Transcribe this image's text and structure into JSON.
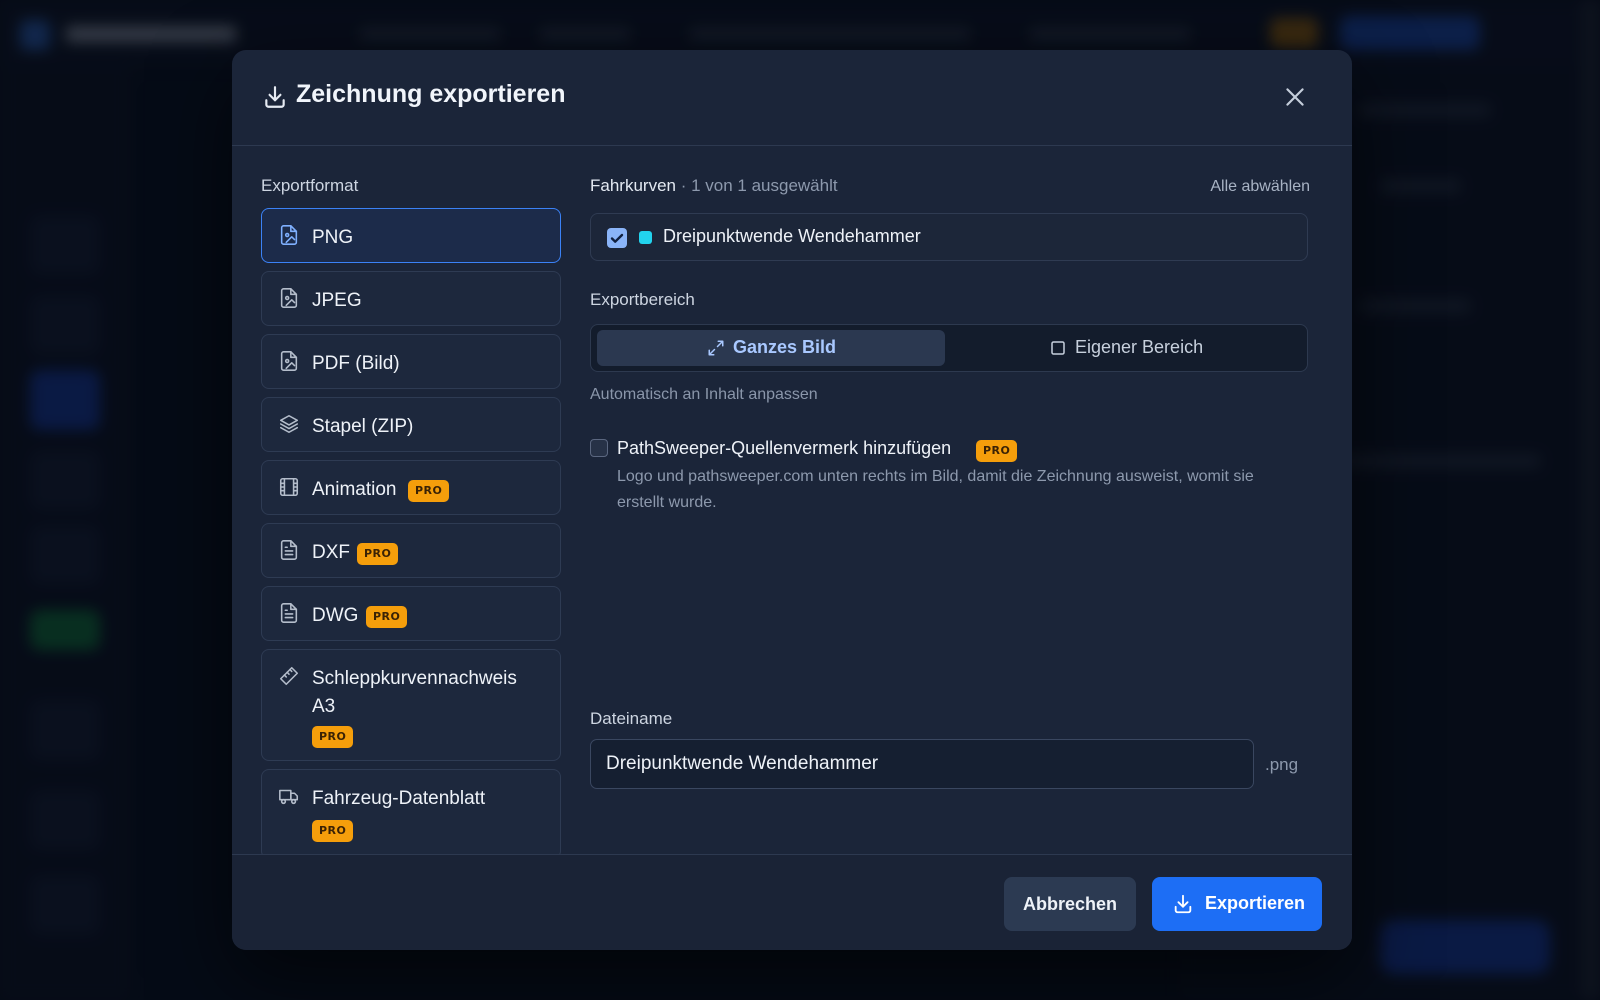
{
  "modal": {
    "title": "Zeichnung exportieren",
    "icons": {
      "header": "download-icon",
      "close": "close-icon"
    }
  },
  "formats": {
    "label": "Exportformat",
    "pro_badge": "PRO",
    "items": [
      {
        "name": "PNG",
        "icon": "image-file-icon",
        "pro": false,
        "selected": true
      },
      {
        "name": "JPEG",
        "icon": "image-file-icon",
        "pro": false,
        "selected": false
      },
      {
        "name": "PDF (Bild)",
        "icon": "image-file-icon",
        "pro": false,
        "selected": false
      },
      {
        "name": "Stapel (ZIP)",
        "icon": "layers-icon",
        "pro": false,
        "selected": false
      },
      {
        "name": "Animation",
        "icon": "film-icon",
        "pro": true,
        "selected": false
      },
      {
        "name": "DXF",
        "icon": "document-icon",
        "pro": true,
        "selected": false
      },
      {
        "name": "DWG",
        "icon": "document-icon",
        "pro": true,
        "selected": false
      },
      {
        "name_line1": "Schleppkurvennachweis",
        "name_line2": "A3",
        "icon": "ruler-icon",
        "pro": true,
        "selected": false
      },
      {
        "name": "Fahrzeug-Datenblatt",
        "icon": "truck-icon",
        "pro": true,
        "selected": false
      }
    ]
  },
  "curves": {
    "label": "Fahrkurven",
    "count_text": "· 1 von 1 ausgewählt",
    "deselect_all": "Alle abwählen",
    "items": [
      {
        "name": "Dreipunktwende Wendehammer",
        "checked": true,
        "color": "#22d3ee"
      }
    ]
  },
  "export_area": {
    "label": "Exportbereich",
    "options": [
      {
        "label": "Ganzes Bild",
        "icon": "expand-icon",
        "active": true
      },
      {
        "label": "Eigener Bereich",
        "icon": "square-icon",
        "active": false
      }
    ],
    "hint": "Automatisch an Inhalt anpassen"
  },
  "credit": {
    "label": "PathSweeper-Quellenvermerk hinzufügen",
    "checked": false,
    "pro": true,
    "description": "Logo und pathsweeper.com unten rechts im Bild, damit die Zeichnung ausweist, womit sie erstellt wurde."
  },
  "filename": {
    "label": "Dateiname",
    "value": "Dreipunktwende Wendehammer",
    "extension": ".png"
  },
  "footer": {
    "cancel_label": "Abbrechen",
    "export_label": "Exportieren"
  },
  "colors": {
    "accent": "#3b82f6",
    "export_button": "#1d6ef5",
    "pro_badge": "#f59e0b",
    "curve_color": "#22d3ee"
  }
}
